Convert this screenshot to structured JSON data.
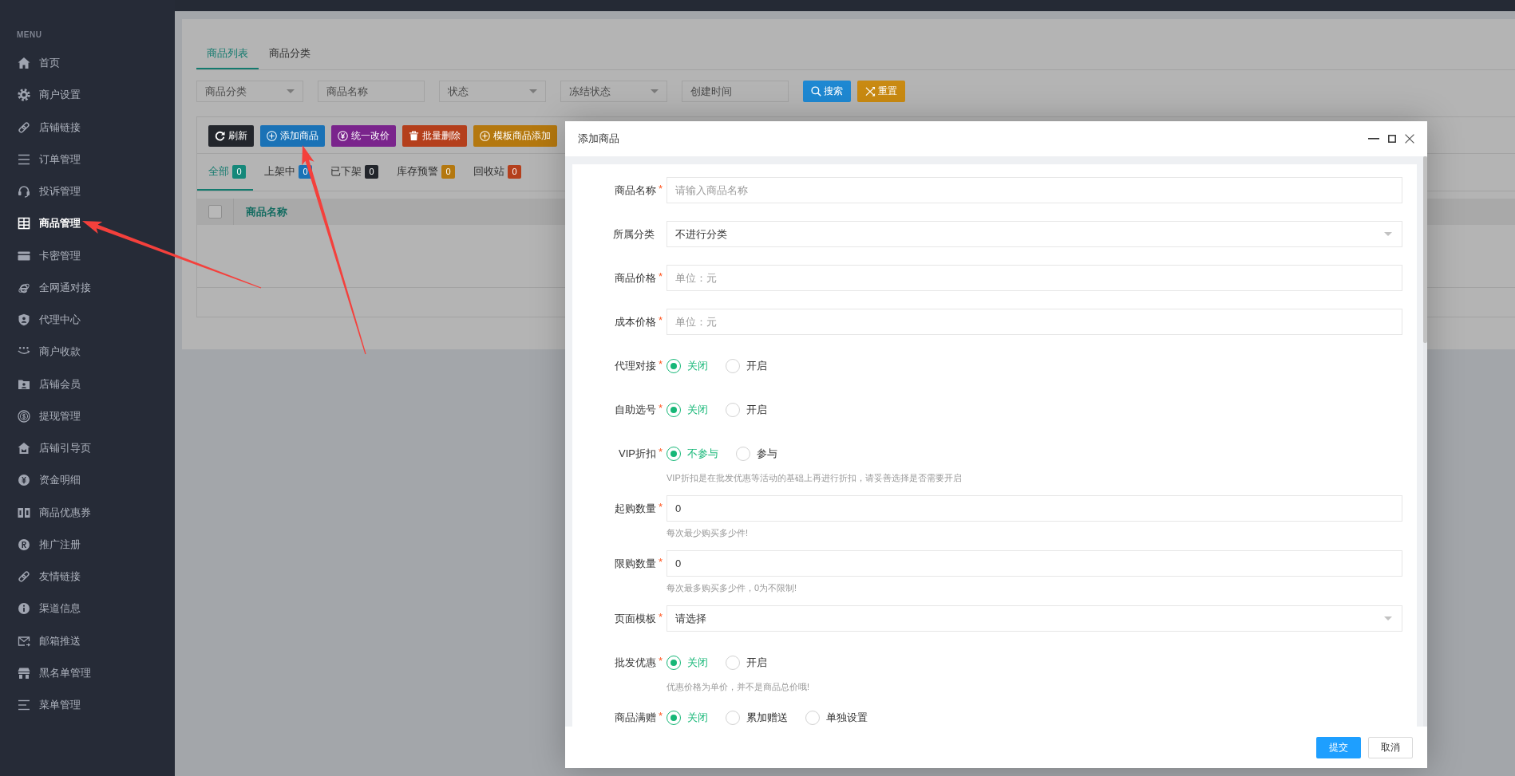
{
  "sidebar": {
    "menu_label": "MENU",
    "items": [
      {
        "label": "首页",
        "selected": false
      },
      {
        "label": "商户设置",
        "selected": false
      },
      {
        "label": "店铺链接",
        "selected": false
      },
      {
        "label": "订单管理",
        "selected": false
      },
      {
        "label": "投诉管理",
        "selected": false
      },
      {
        "label": "商品管理",
        "selected": true
      },
      {
        "label": "卡密管理",
        "selected": false
      },
      {
        "label": "全网通对接",
        "selected": false
      },
      {
        "label": "代理中心",
        "selected": false
      },
      {
        "label": "商户收款",
        "selected": false
      },
      {
        "label": "店铺会员",
        "selected": false
      },
      {
        "label": "提现管理",
        "selected": false
      },
      {
        "label": "店铺引导页",
        "selected": false
      },
      {
        "label": "资金明细",
        "selected": false
      },
      {
        "label": "商品优惠券",
        "selected": false
      },
      {
        "label": "推广注册",
        "selected": false
      },
      {
        "label": "友情链接",
        "selected": false
      },
      {
        "label": "渠道信息",
        "selected": false
      },
      {
        "label": "邮箱推送",
        "selected": false
      },
      {
        "label": "黑名单管理",
        "selected": false
      },
      {
        "label": "菜单管理",
        "selected": false
      }
    ]
  },
  "page_tabs": [
    {
      "label": "商品列表",
      "selected": true
    },
    {
      "label": "商品分类",
      "selected": false
    }
  ],
  "filters": {
    "fields": [
      {
        "kind": "select",
        "placeholder": "商品分类"
      },
      {
        "kind": "input",
        "placeholder": "商品名称"
      },
      {
        "kind": "select",
        "placeholder": "状态"
      },
      {
        "kind": "select",
        "placeholder": "冻结状态"
      },
      {
        "kind": "input",
        "placeholder": "创建时间"
      }
    ],
    "buttons": [
      {
        "label": "搜索",
        "color": "#1e88d2"
      },
      {
        "label": "重置",
        "color": "#c98a12"
      }
    ]
  },
  "toolbar": {
    "buttons": [
      {
        "label": "刷新",
        "color": "#23262c"
      },
      {
        "label": "添加商品",
        "color": "#1a72b6"
      },
      {
        "label": "统一改价",
        "color": "#7a248c"
      },
      {
        "label": "批量删除",
        "color": "#b43f1c"
      },
      {
        "label": "模板商品添加",
        "color": "#b4780f"
      }
    ]
  },
  "status_tabs": [
    {
      "label": "全部",
      "count": "0",
      "selected": true,
      "color": "#15887a"
    },
    {
      "label": "上架中",
      "count": "0",
      "selected": false,
      "color": "#1a72b6"
    },
    {
      "label": "已下架",
      "count": "0",
      "selected": false,
      "color": "#22252b"
    },
    {
      "label": "库存预警",
      "count": "0",
      "selected": false,
      "color": "#b4780f"
    },
    {
      "label": "回收站",
      "count": "0",
      "selected": false,
      "color": "#b43f1c"
    }
  ],
  "table": {
    "select_all": {
      "checked": false
    },
    "columns": [
      "商品名称"
    ]
  },
  "dialog": {
    "title": "添加商品",
    "fields": [
      {
        "kind": "input",
        "label": "商品名称",
        "required_mark": "*",
        "placeholder": "请输入商品名称"
      },
      {
        "kind": "select",
        "label": "所属分类",
        "value": "不进行分类"
      },
      {
        "kind": "input",
        "label": "商品价格",
        "required_mark": "*",
        "placeholder": "单位：元"
      },
      {
        "kind": "input",
        "label": "成本价格",
        "required_mark": "*",
        "placeholder": "单位：元"
      },
      {
        "kind": "radio",
        "label": "代理对接",
        "required_mark": "*",
        "options": [
          {
            "label": "关闭",
            "selected": true
          },
          {
            "label": "开启",
            "selected": false
          }
        ]
      },
      {
        "kind": "radio",
        "label": "自助选号",
        "required_mark": "*",
        "options": [
          {
            "label": "关闭",
            "selected": true
          },
          {
            "label": "开启",
            "selected": false
          }
        ]
      },
      {
        "kind": "radio",
        "label": "VIP折扣",
        "required_mark": "*",
        "options": [
          {
            "label": "不参与",
            "selected": true
          },
          {
            "label": "参与",
            "selected": false
          }
        ],
        "hint": "VIP折扣是在批发优惠等活动的基础上再进行折扣，请妥善选择是否需要开启"
      },
      {
        "kind": "input",
        "label": "起购数量",
        "required_mark": "*",
        "value": "0",
        "hint": "每次最少购买多少件!"
      },
      {
        "kind": "input",
        "label": "限购数量",
        "required_mark": "*",
        "value": "0",
        "hint": "每次最多购买多少件，0为不限制!"
      },
      {
        "kind": "select",
        "label": "页面模板",
        "required_mark": "*",
        "value": "请选择"
      },
      {
        "kind": "radio",
        "label": "批发优惠",
        "required_mark": "*",
        "options": [
          {
            "label": "关闭",
            "selected": true
          },
          {
            "label": "开启",
            "selected": false
          }
        ],
        "hint": "优惠价格为单价，并不是商品总价哦!"
      },
      {
        "kind": "radio",
        "label": "商品满赠",
        "required_mark": "*",
        "options": [
          {
            "label": "关闭",
            "selected": true
          },
          {
            "label": "累加赠送",
            "selected": false
          },
          {
            "label": "单独设置",
            "selected": false
          }
        ]
      }
    ],
    "buttons": [
      {
        "label": "提交",
        "kind": "primary"
      },
      {
        "label": "取消",
        "kind": "default"
      }
    ]
  }
}
